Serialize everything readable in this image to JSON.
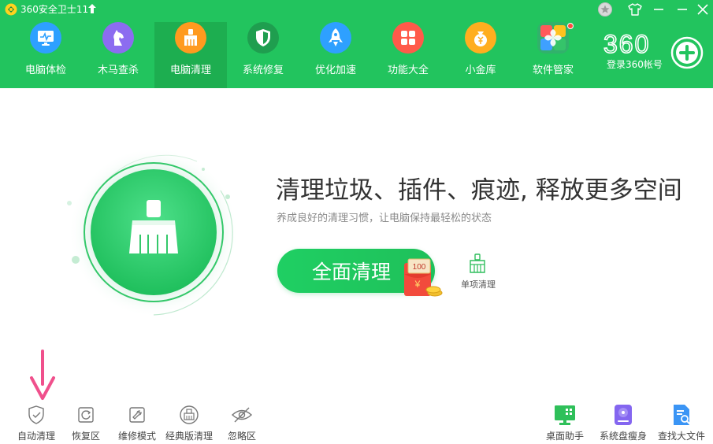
{
  "titlebar": {
    "app_title": "360安全卫士11",
    "icons": [
      "app-logo-icon",
      "upgrade-arrow-icon",
      "medal-icon",
      "skin-shirt-icon",
      "minimize-icon",
      "close-icon"
    ]
  },
  "nav": {
    "items": [
      {
        "label": "电脑体检",
        "icon": "monitor-icon",
        "color": "#2ea0ff"
      },
      {
        "label": "木马查杀",
        "icon": "horse-icon",
        "color": "#8c6cf0"
      },
      {
        "label": "电脑清理",
        "icon": "broom-icon",
        "color": "#ff9a1f",
        "active": true
      },
      {
        "label": "系统修复",
        "icon": "shield-icon",
        "color": "#1f9e4f"
      },
      {
        "label": "优化加速",
        "icon": "rocket-icon",
        "color": "#2ea0ff"
      },
      {
        "label": "功能大全",
        "icon": "grid-icon",
        "color": "#ff5a4a"
      },
      {
        "label": "小金库",
        "icon": "coin-icon",
        "color": "#ffae1f"
      },
      {
        "label": "软件管家",
        "icon": "apps-icon",
        "color": "#31b26b",
        "badge": true
      }
    ]
  },
  "brand": {
    "logo_text": "360",
    "login_label": "登录360帐号"
  },
  "main": {
    "headline": "清理垃圾、插件、痕迹, 释放更多空间",
    "subline": "养成良好的清理习惯，让电脑保持最轻松的状态",
    "primary_button": "全面清理",
    "redpacket_amount": "100",
    "redpacket_symbol": "¥",
    "single_clean_label": "单项清理"
  },
  "bottom_left": [
    {
      "label": "自动清理",
      "icon": "shield-check-icon"
    },
    {
      "label": "恢复区",
      "icon": "restore-icon"
    },
    {
      "label": "维修模式",
      "icon": "wrench-icon"
    },
    {
      "label": "经典版清理",
      "icon": "classic-clean-icon"
    },
    {
      "label": "忽略区",
      "icon": "eye-off-icon"
    }
  ],
  "bottom_right": [
    {
      "label": "桌面助手",
      "icon": "desktop-icon",
      "color": "#2fc05a"
    },
    {
      "label": "系统盘瘦身",
      "icon": "disk-icon",
      "color": "#8466f0"
    },
    {
      "label": "查找大文件",
      "icon": "file-search-icon",
      "color": "#3b95f5"
    }
  ],
  "colors": {
    "header_green": "#22c45e",
    "active_tab": "#1dae50",
    "accent_pink": "#f0508c"
  }
}
